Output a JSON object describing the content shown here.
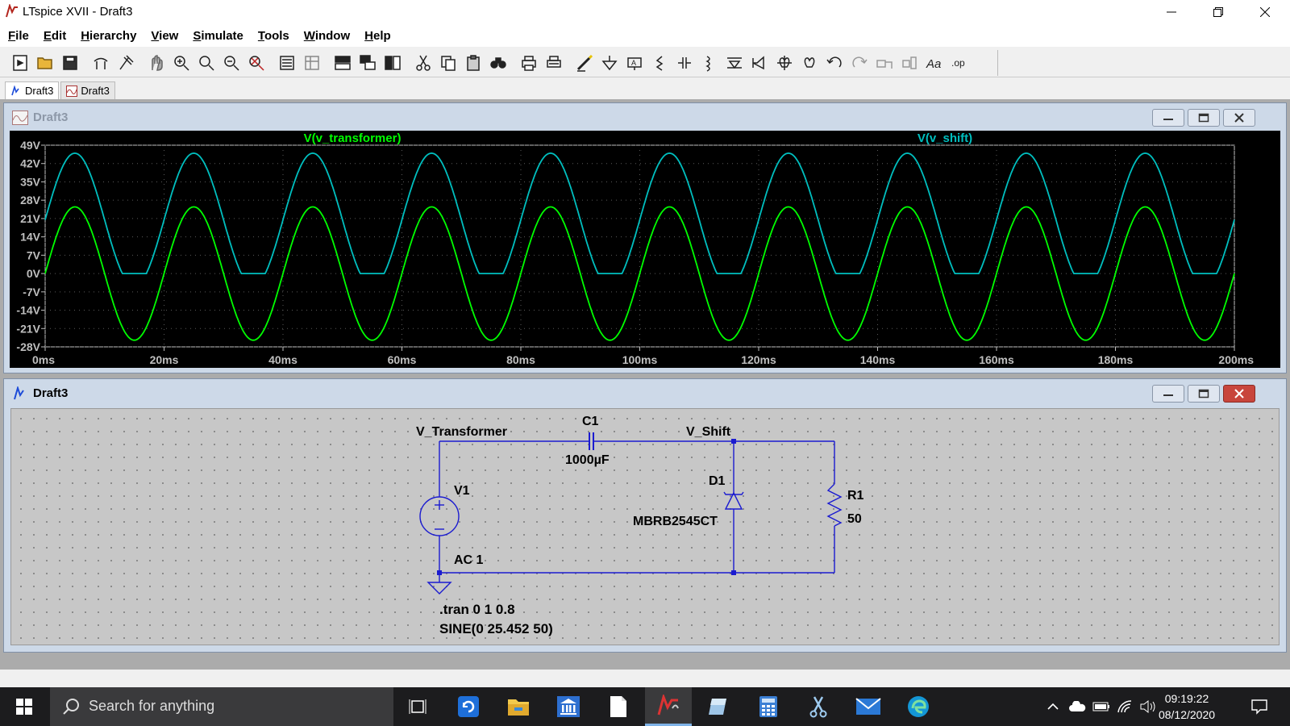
{
  "window": {
    "title": "LTspice XVII - Draft3",
    "controls": [
      "minimize-icon",
      "restore-icon",
      "close-icon"
    ]
  },
  "menu": {
    "items": [
      "File",
      "Edit",
      "Hierarchy",
      "View",
      "Simulate",
      "Tools",
      "Window",
      "Help"
    ]
  },
  "toolbar": {
    "icons": [
      "new-schematic-icon",
      "open-icon",
      "save-icon",
      "control-panel-icon",
      "run-icon",
      "halt-icon",
      "zoom-in-icon",
      "zoom-pan-icon",
      "zoom-out-icon",
      "zoom-fit-icon",
      "autorange-icon",
      "grid-icon",
      "tile-horizontal-icon",
      "cascade-icon",
      "tile-vertical-icon",
      "cut-icon",
      "copy-icon",
      "paste-icon",
      "find-icon",
      "print-icon",
      "print-preview-icon",
      "wire-icon",
      "ground-icon",
      "label-net-icon",
      "resistor-icon",
      "capacitor-icon",
      "inductor-icon",
      "diode-icon",
      "component-icon",
      "move-icon",
      "drag-icon",
      "undo-icon",
      "redo-icon",
      "rotate-icon",
      "mirror-icon",
      "text-icon",
      "spice-directive-icon"
    ]
  },
  "tabs": [
    {
      "label": "Draft3",
      "kind": "schematic"
    },
    {
      "label": "Draft3",
      "kind": "waveform"
    }
  ],
  "waveform_window": {
    "title": "Draft3"
  },
  "schematic_window": {
    "title": "Draft3"
  },
  "chart_data": {
    "type": "line",
    "xlabel": "",
    "ylabel": "",
    "xlim": [
      0,
      200
    ],
    "ylim": [
      -28,
      49
    ],
    "x_ticks": [
      "0ms",
      "20ms",
      "40ms",
      "60ms",
      "80ms",
      "100ms",
      "120ms",
      "140ms",
      "160ms",
      "180ms",
      "200ms"
    ],
    "y_ticks": [
      "49V",
      "42V",
      "35V",
      "28V",
      "21V",
      "14V",
      "7V",
      "0V",
      "-7V",
      "-14V",
      "-21V",
      "-28V"
    ],
    "series": [
      {
        "name": "V(v_transformer)",
        "color": "#00ff00",
        "kind": "sine",
        "amplitude": 25.452,
        "frequency_hz": 50,
        "offset": 0
      },
      {
        "name": "V(v_shift)",
        "color": "#00bfbf",
        "kind": "clamped-sine",
        "amplitude": 25.452,
        "frequency_hz": 50,
        "offset": 20.5,
        "floor": 0
      }
    ],
    "grid": true
  },
  "schematic": {
    "net_labels": {
      "v_transformer": "V_Transformer",
      "v_shift": "V_Shift"
    },
    "c1": {
      "ref": "C1",
      "value": "1000µF"
    },
    "d1": {
      "ref": "D1",
      "value": "MBRB2545CT"
    },
    "r1": {
      "ref": "R1",
      "value": "50"
    },
    "v1": {
      "ref": "V1",
      "value": "AC 1"
    },
    "directives": {
      "tran": ".tran 0 1 0.8",
      "sine": "SINE(0 25.452 50)"
    }
  },
  "taskbar": {
    "search_placeholder": "Search for anything",
    "time": "09:19:22",
    "date": "08/12/2020",
    "apps": [
      "task-view-icon",
      "refresh-app-icon",
      "file-explorer-icon",
      "bank-icon",
      "document-icon",
      "ltspice-icon",
      "glass-app-icon",
      "calculator-icon",
      "snipping-tool-icon",
      "mail-icon",
      "edge-icon"
    ]
  }
}
